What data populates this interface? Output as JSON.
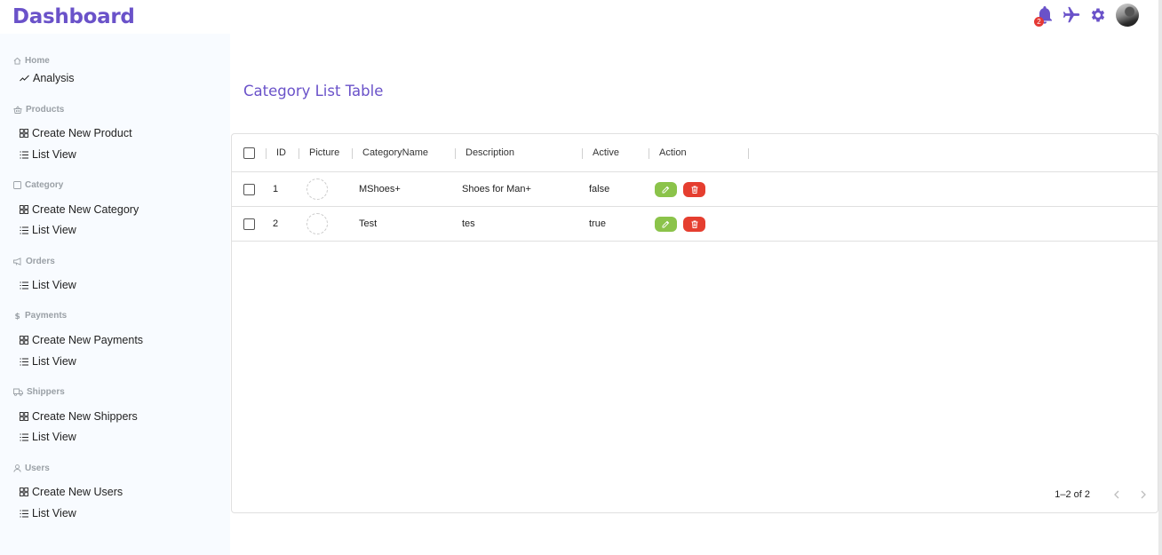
{
  "app": {
    "title": "Dashboard",
    "notification_count": "2",
    "accent_color": "#6a52c9"
  },
  "sidebar": {
    "sections": [
      {
        "title": "Home",
        "icon": "home-icon",
        "items": [
          {
            "label": "Analysis",
            "icon": "trend-icon"
          }
        ]
      },
      {
        "title": "Products",
        "icon": "basket-icon",
        "items": [
          {
            "label": "Create New Product",
            "icon": "grid-icon"
          },
          {
            "label": "List View",
            "icon": "list-icon"
          }
        ]
      },
      {
        "title": "Category",
        "icon": "square-icon",
        "items": [
          {
            "label": "Create New Category",
            "icon": "grid-icon"
          },
          {
            "label": "List View",
            "icon": "list-icon"
          }
        ]
      },
      {
        "title": "Orders",
        "icon": "megaphone-icon",
        "items": [
          {
            "label": "List View",
            "icon": "list-icon"
          }
        ]
      },
      {
        "title": "Payments",
        "icon": "dollar-icon",
        "items": [
          {
            "label": "Create New Payments",
            "icon": "grid-icon"
          },
          {
            "label": "List View",
            "icon": "list-icon"
          }
        ]
      },
      {
        "title": "Shippers",
        "icon": "truck-icon",
        "items": [
          {
            "label": "Create New Shippers",
            "icon": "grid-icon"
          },
          {
            "label": "List View",
            "icon": "list-icon"
          }
        ]
      },
      {
        "title": "Users",
        "icon": "user-icon",
        "items": [
          {
            "label": "Create New Users",
            "icon": "grid-icon"
          },
          {
            "label": "List View",
            "icon": "list-icon"
          }
        ]
      }
    ]
  },
  "main": {
    "title": "Category List Table",
    "table": {
      "columns": [
        "ID",
        "Picture",
        "CategoryName",
        "Description",
        "Active",
        "Action"
      ],
      "rows": [
        {
          "id": "1",
          "name": "MShoes+",
          "description": "Shoes for Man+",
          "active": "false"
        },
        {
          "id": "2",
          "name": "Test",
          "description": "tes",
          "active": "true"
        }
      ],
      "pagination": "1–2 of 2"
    }
  },
  "colors": {
    "edit_button": "#8bc34a",
    "delete_button": "#e53e2f",
    "badge": "#e53935"
  }
}
